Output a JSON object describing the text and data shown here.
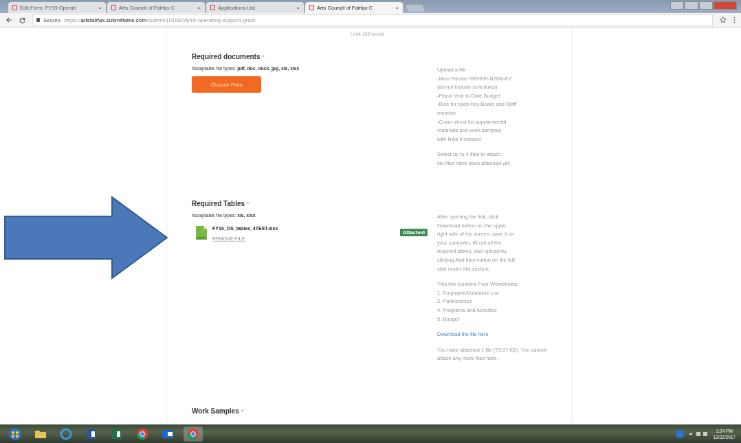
{
  "browser": {
    "tabs": [
      {
        "title": "Edit Form: FY19 Operati",
        "close": "×",
        "selected": false
      },
      {
        "title": "Arts Council of Fairfax C",
        "close": "×",
        "selected": false
      },
      {
        "title": "Applications List",
        "close": "×",
        "selected": false
      },
      {
        "title": "Arts Council of Fairfax C",
        "close": "×",
        "selected": true
      }
    ],
    "address": {
      "secure_label": "Secure",
      "scheme": "https://",
      "host": "artsfairfax.submittable.com",
      "path": "/submit/101587/fy19-operating-support-grant"
    }
  },
  "limit_note": "Limit 150 words",
  "sections": [
    {
      "kind": "upload",
      "title": "Required documents",
      "required_mark": "*",
      "types_label": "Acceptable file types: ",
      "types": "pdf, doc, docx, jpg, xls, xlsx",
      "button": "Choose Files",
      "help": [
        [
          "Upload a file",
          "-Most Recent 990/990-N/990-EZ",
          "(do not include schedules)",
          "-Fiscal Year to Date Budget",
          "-Bios for each Key Board and Staff",
          "member",
          "-Cover sheet for supplemental",
          "materials and work samples",
          "with links if needed"
        ],
        [
          "Select up to 4 files to attach.",
          "No files have been attached yet."
        ]
      ]
    },
    {
      "kind": "attached",
      "title": "Required Tables",
      "required_mark": "*",
      "types_label": "Acceptable file types: ",
      "types": "xls, xlsx",
      "file": {
        "name": "FY19_OS_tables_4TEST.xlsx",
        "remove": "REMOVE FILE",
        "status": "Attached"
      },
      "help": [
        [
          "After opening the link, click",
          "Download button on the upper",
          "right side of the screen; save it on",
          "your computer, fill out all the",
          "required tables, and upload by",
          "clicking Add files button on the left",
          "side under this section."
        ],
        [
          "This link contains Four Worksheets:",
          "1. Employee/Volunteer List",
          "2. Partnerships",
          "4. Programs and Activities",
          "5. Budget"
        ]
      ],
      "link": "Download the file here",
      "after": "You have attached 1 file (73.97 KB). You cannot attach any more files here."
    },
    {
      "kind": "heading",
      "title": "Work Samples",
      "required_mark": "*"
    }
  ],
  "taskbar": {
    "time": "1:24 PM",
    "date": "12/22/2017"
  }
}
